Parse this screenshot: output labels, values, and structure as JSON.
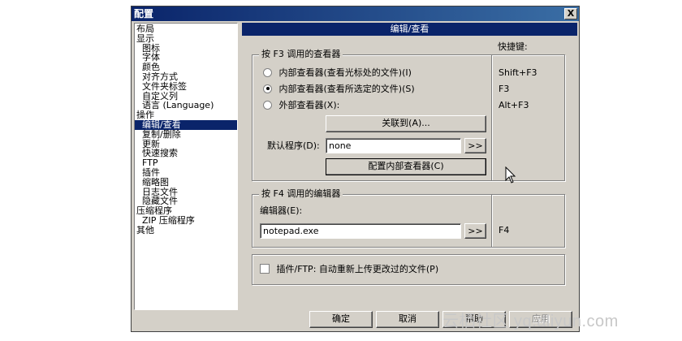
{
  "window": {
    "title": "配置",
    "close_label": "X"
  },
  "tree": {
    "items": [
      {
        "label": "布局",
        "level": 0
      },
      {
        "label": "显示",
        "level": 0
      },
      {
        "label": "图标",
        "level": 1
      },
      {
        "label": "字体",
        "level": 1
      },
      {
        "label": "颜色",
        "level": 1
      },
      {
        "label": "对齐方式",
        "level": 1
      },
      {
        "label": "文件夹标签",
        "level": 1
      },
      {
        "label": "自定义列",
        "level": 1
      },
      {
        "label": "语言 (Language)",
        "level": 1
      },
      {
        "label": "操作",
        "level": 0
      },
      {
        "label": "编辑/查看",
        "level": 1,
        "selected": true
      },
      {
        "label": "复制/删除",
        "level": 1
      },
      {
        "label": "更新",
        "level": 1
      },
      {
        "label": "快速搜索",
        "level": 1
      },
      {
        "label": "FTP",
        "level": 1
      },
      {
        "label": "插件",
        "level": 1
      },
      {
        "label": "缩略图",
        "level": 1
      },
      {
        "label": "日志文件",
        "level": 1
      },
      {
        "label": "隐藏文件",
        "level": 1
      },
      {
        "label": "压缩程序",
        "level": 0
      },
      {
        "label": "ZIP 压缩程序",
        "level": 1
      },
      {
        "label": "其他",
        "level": 0
      }
    ]
  },
  "pane": {
    "title": "编辑/查看",
    "hotkey_title": "快捷键:",
    "viewer_group": {
      "label": "按 F3 调用的查看器",
      "radios": [
        {
          "label": "内部查看器(查看光标处的文件)(I)",
          "hotkey": "Shift+F3",
          "checked": false
        },
        {
          "label": "内部查看器(查看所选定的文件)(S)",
          "hotkey": "F3",
          "checked": true
        },
        {
          "label": "外部查看器(X):",
          "hotkey": "Alt+F3",
          "checked": false
        }
      ],
      "associate_button": "关联到(A)...",
      "default_program_label": "默认程序(D):",
      "default_program_value": "none",
      "browse_button": ">>",
      "configure_button": "配置内部查看器(C)"
    },
    "editor_group": {
      "label": "按 F4 调用的编辑器",
      "editor_label": "编辑器(E):",
      "editor_value": "notepad.exe",
      "browse_button": ">>",
      "hotkey": "F4"
    },
    "plugin_ftp": {
      "label": "插件/FTP: 自动重新上传更改过的文件(P)",
      "checked": false
    }
  },
  "footer": {
    "ok": "确定",
    "cancel": "取消",
    "help": "帮助",
    "apply": "应用"
  },
  "watermark": "云栖社区 yq.aliyun.com"
}
